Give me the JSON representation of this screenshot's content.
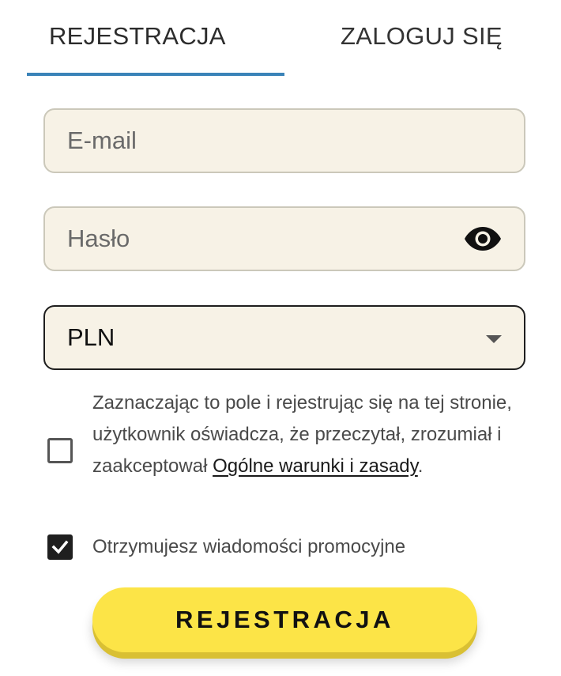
{
  "tabs": {
    "register_label": "REJESTRACJA",
    "login_label": "ZALOGUJ SIĘ",
    "active": "register",
    "active_color": "#3a83b8"
  },
  "form": {
    "email_placeholder": "E-mail",
    "password_placeholder": "Hasło",
    "password_toggle_icon": "eye-icon",
    "currency_selected": "PLN",
    "currency_caret_icon": "chevron-down-icon",
    "field_background": "#f7f2e6"
  },
  "terms": {
    "checked": false,
    "text_before_link": "Zaznaczając to pole i rejestrując się na tej stronie, użytkownik oświadcza, że przeczytał, zrozumiał i zaakceptował ",
    "link_text": "Ogólne warunki i zasady",
    "text_after_link": "."
  },
  "promo": {
    "checked": true,
    "label": "Otrzymujesz wiadomości promocyjne"
  },
  "submit": {
    "label": "REJESTRACJA",
    "color": "#fce447"
  }
}
